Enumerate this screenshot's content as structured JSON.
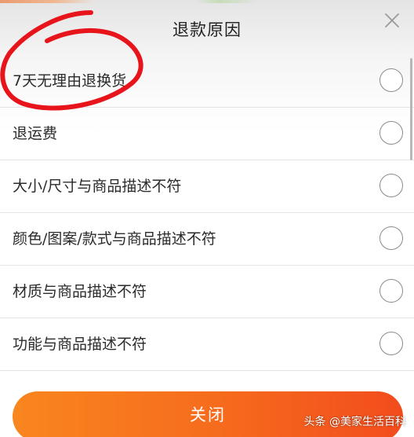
{
  "dialog": {
    "title": "退款原因",
    "close_icon": "close-icon"
  },
  "reasons": [
    {
      "label": "7天无理由退换货",
      "selected": false
    },
    {
      "label": "退运费",
      "selected": false
    },
    {
      "label": "大小/尺寸与商品描述不符",
      "selected": false
    },
    {
      "label": "颜色/图案/款式与商品描述不符",
      "selected": false
    },
    {
      "label": "材质与商品描述不符",
      "selected": false
    },
    {
      "label": "功能与商品描述不符",
      "selected": false
    }
  ],
  "footer": {
    "close_label": "关闭"
  },
  "watermark": {
    "text": "头条 @美家生活百科"
  },
  "colors": {
    "button_start": "#f9861f",
    "button_end": "#f24c1d",
    "annotation_red": "#e8141c",
    "radio_border": "#8a8a8a"
  }
}
